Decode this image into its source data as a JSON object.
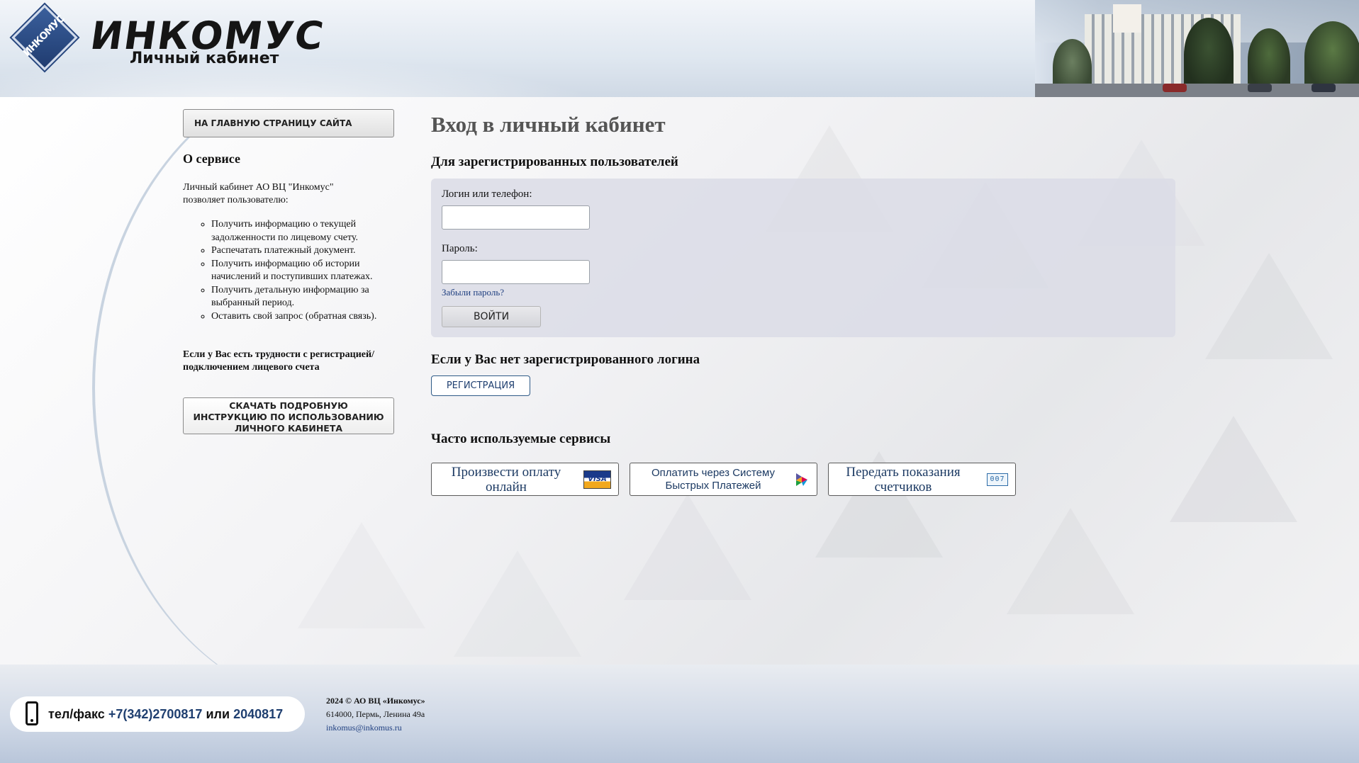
{
  "header": {
    "logo_badge_text": "ИНКОМУС",
    "logo_title": "ИНКОМУС",
    "logo_subtitle": "Личный кабинет"
  },
  "sidebar": {
    "home_button": "НА ГЛАВНУЮ СТРАНИЦУ САЙТА",
    "about_title": "О сервисе",
    "about_desc": "Личный кабинет АО ВЦ \"Инкомус\" позволяет пользователю:",
    "features": [
      "Получить информацию о текущей задолженности по лицевому счету.",
      "Распечатать платежный документ.",
      "Получить информацию об истории начислений и поступивших платежах.",
      "Получить детальную информацию за выбранный период.",
      "Оставить свой запрос (обратная связь)."
    ],
    "hint": "Если у Вас есть трудности с регистрацией/подключением лицевого счета",
    "instruction_button": "СКАЧАТЬ ПОДРОБНУЮ ИНСТРУКЦИЮ ПО ИСПОЛЬЗОВАНИЮ ЛИЧНОГО КАБИНЕТА"
  },
  "main": {
    "title": "Вход в личный кабинет",
    "registered_heading": "Для зарегистрированных пользователей",
    "login_label": "Логин или телефон:",
    "login_value": "",
    "password_label": "Пароль:",
    "password_value": "",
    "forgot_link": "Забыли пароль?",
    "login_button": "ВОЙТИ",
    "unregistered_heading": "Если у Вас нет зарегистрированного логина",
    "register_button": "РЕГИСТРАЦИЯ",
    "services_heading": "Часто используемые сервисы",
    "services": [
      {
        "label": "Произвести оплату онлайн",
        "icon": "visa-card-icon"
      },
      {
        "label": "Оплатить через Систему Быстрых Платежей",
        "icon": "sbp-icon"
      },
      {
        "label": "Передать показания счетчиков",
        "icon": "meter-icon"
      }
    ],
    "visa_text": "VISA",
    "meter_text": "007"
  },
  "footer": {
    "phone_prefix": "тел/факс",
    "phone_1": "+7(342)2700817",
    "phone_sep": "или",
    "phone_2": "2040817",
    "copyright": "2024 © АО ВЦ «Инкомус»",
    "address": "614000, Пермь, Ленина 49а",
    "email": "inkomus@inkomus.ru"
  },
  "colors": {
    "accent_blue": "#1f3f70",
    "link_blue": "#1f3f80",
    "panel_bg": "#dadce6"
  }
}
